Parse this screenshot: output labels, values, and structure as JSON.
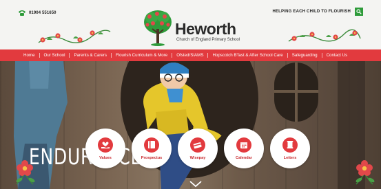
{
  "header": {
    "phone": "01904 551650",
    "slogan": "HELPING EACH CHILD TO FLOURISH",
    "logo": {
      "name": "Heworth",
      "subtitle": "Church of England Primary School"
    }
  },
  "nav": {
    "items": [
      {
        "label": "Home"
      },
      {
        "label": "Our School"
      },
      {
        "label": "Parents & Carers"
      },
      {
        "label": "Flourish Curriculum & More"
      },
      {
        "label": "Ofsted/SIAMS"
      },
      {
        "label": "Hopscotch B'fast & After School Care"
      },
      {
        "label": "Safeguarding"
      },
      {
        "label": "Contact Us"
      }
    ]
  },
  "hero": {
    "headline": "ENDURANCE"
  },
  "quick_links": [
    {
      "label": "Values",
      "icon": "hand-heart-icon"
    },
    {
      "label": "Prospectus",
      "icon": "book-icon"
    },
    {
      "label": "Wisepay",
      "icon": "card-icon"
    },
    {
      "label": "Calendar",
      "icon": "calendar-icon"
    },
    {
      "label": "Letters",
      "icon": "letter-icon"
    }
  ],
  "colors": {
    "accent_red": "#e23a3e",
    "search_green": "#2e9b3a",
    "header_bg": "#f4f4f2"
  }
}
